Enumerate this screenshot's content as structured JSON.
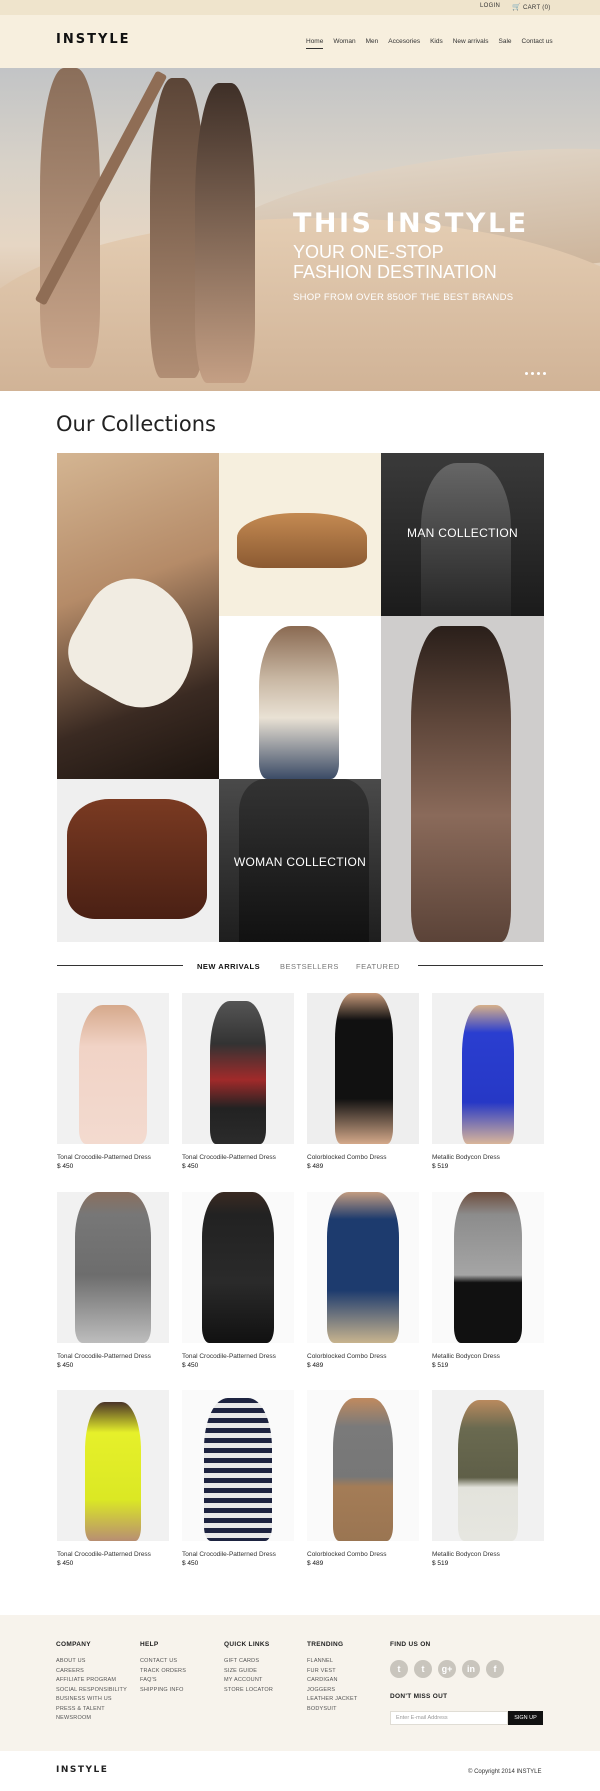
{
  "topbar": {
    "login": "LOGIN",
    "cart": "CART (0)"
  },
  "header": {
    "logo": "INSTYLE",
    "nav": [
      "Home",
      "Woman",
      "Men",
      "Accesories",
      "Kids",
      "New arrivals",
      "Sale",
      "Contact us"
    ],
    "active": "Home"
  },
  "hero": {
    "title": "THIS INSTYLE",
    "subtitle_line1": "YOUR ONE-STOP",
    "subtitle_line2": "FASHION DESTINATION",
    "tagline": "SHOP FROM OVER 850OF THE BEST BRANDS"
  },
  "collections": {
    "title": "Our Collections",
    "man_label": "MAN COLLECTION",
    "woman_label": "WOMAN COLLECTION"
  },
  "tabs": [
    "NEW ARRIVALS",
    "BESTSELLERS",
    "FEATURED"
  ],
  "products": [
    [
      {
        "name": "Tonal Crocodile-Patterned Dress",
        "price": "$ 450"
      },
      {
        "name": "Tonal Crocodile-Patterned Dress",
        "price": "$ 450"
      },
      {
        "name": "Colorblocked Combo Dress",
        "price": "$ 489"
      },
      {
        "name": "Metallic Bodycon Dress",
        "price": "$ 519"
      }
    ],
    [
      {
        "name": "Tonal Crocodile-Patterned Dress",
        "price": "$ 450"
      },
      {
        "name": "Tonal Crocodile-Patterned Dress",
        "price": "$ 450"
      },
      {
        "name": "Colorblocked Combo Dress",
        "price": "$ 489"
      },
      {
        "name": "Metallic Bodycon Dress",
        "price": "$ 519"
      }
    ],
    [
      {
        "name": "Tonal Crocodile-Patterned Dress",
        "price": "$ 450"
      },
      {
        "name": "Tonal Crocodile-Patterned Dress",
        "price": "$ 450"
      },
      {
        "name": "Colorblocked Combo Dress",
        "price": "$ 489"
      },
      {
        "name": "Metallic Bodycon Dress",
        "price": "$ 519"
      }
    ]
  ],
  "footer": {
    "company": {
      "title": "COMPANY",
      "items": [
        "ABOUT US",
        "CAREERS",
        "AFFILIATE PROGRAM",
        "SOCIAL RESPONSIBILITY",
        "BUSINESS WITH US",
        "PRESS & TALENT",
        "NEWSROOM"
      ]
    },
    "help": {
      "title": "HELP",
      "items": [
        "CONTACT US",
        "TRACK ORDERS",
        "FAQ'S",
        "SHIPPING INFO"
      ]
    },
    "quick": {
      "title": "QUICK LINKS",
      "items": [
        "GIFT CARDS",
        "SIZE GUIDE",
        "MY ACCOUNT",
        "STORE LOCATOR"
      ]
    },
    "trending": {
      "title": "TRENDING",
      "items": [
        "FLANNEL",
        "FUR VEST",
        "CARDIGAN",
        "JOGGERS",
        "LEATHER JACKET",
        "BODYSUIT"
      ]
    },
    "find_us": "FIND US ON",
    "social": [
      "t",
      "t",
      "g+",
      "in",
      "f"
    ],
    "dont_miss": "DON'T MISS OUT",
    "email_placeholder": "Enter E-mail Address",
    "signup": "SIGN UP",
    "bottom_logo": "INSTYLE",
    "copyright": "© Copyright 2014 INSTYLE"
  }
}
